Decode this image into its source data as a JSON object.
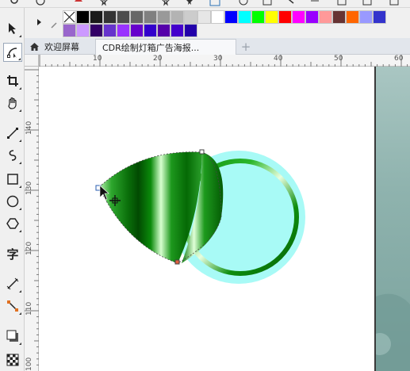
{
  "tabs": {
    "home_label": "欢迎屏幕",
    "document_label": "CDR绘制灯箱广告海报...",
    "add_label": "+"
  },
  "toolbox": {
    "text_tool_glyph": "字"
  },
  "ruler": {
    "horizontal_ticks": [
      "10",
      "20",
      "30",
      "40",
      "50",
      "60"
    ],
    "vertical_ticks": [
      "140",
      "130",
      "120",
      "110",
      "100"
    ]
  },
  "palette": {
    "row1": [
      "#000000",
      "#1a1a1a",
      "#333333",
      "#4d4d4d",
      "#666666",
      "#808080",
      "#999999",
      "#b3b3b3",
      "#cccccc",
      "#e6e6e6",
      "#ffffff",
      "#0000ff",
      "#00ffff",
      "#00ff00",
      "#ffff00",
      "#ff0000",
      "#ff00ff",
      "#9900ff",
      "#ff9999",
      "#663333",
      "#ff6600",
      "#9999ff",
      "#3333cc"
    ],
    "row2": [
      "#9966cc",
      "#cc99ff",
      "#330066",
      "#6633cc",
      "#9933ff",
      "#6600cc",
      "#3300cc",
      "#5500aa",
      "#4400cc",
      "#2200aa"
    ]
  },
  "colors": {
    "accent_green": "#0a8a0a",
    "circle_fill": "#a8faf6",
    "desk_bg": "#8fb3ae"
  }
}
